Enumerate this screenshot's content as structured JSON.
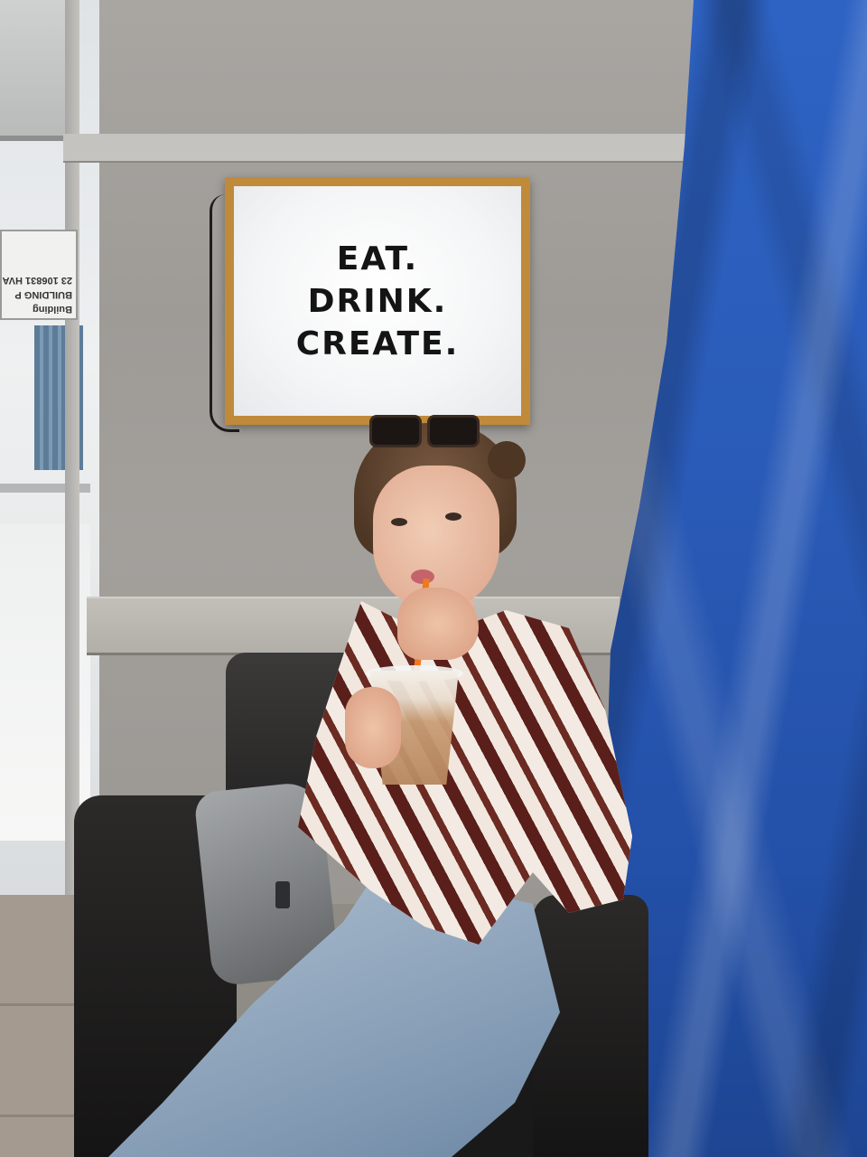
{
  "sign": {
    "lines": [
      "EAT.",
      "DRINK.",
      "CREATE."
    ],
    "frame_color": "#c08a3b"
  },
  "building_sign": {
    "line1": "Building",
    "line2": "BUILDING P",
    "line3": "23 106831 HVA"
  },
  "colors": {
    "tarp": "#2a5bb8",
    "wall": "#a3a09c",
    "blouse_stripe": "#5a1f1a",
    "straw": "#ee7a1f"
  }
}
